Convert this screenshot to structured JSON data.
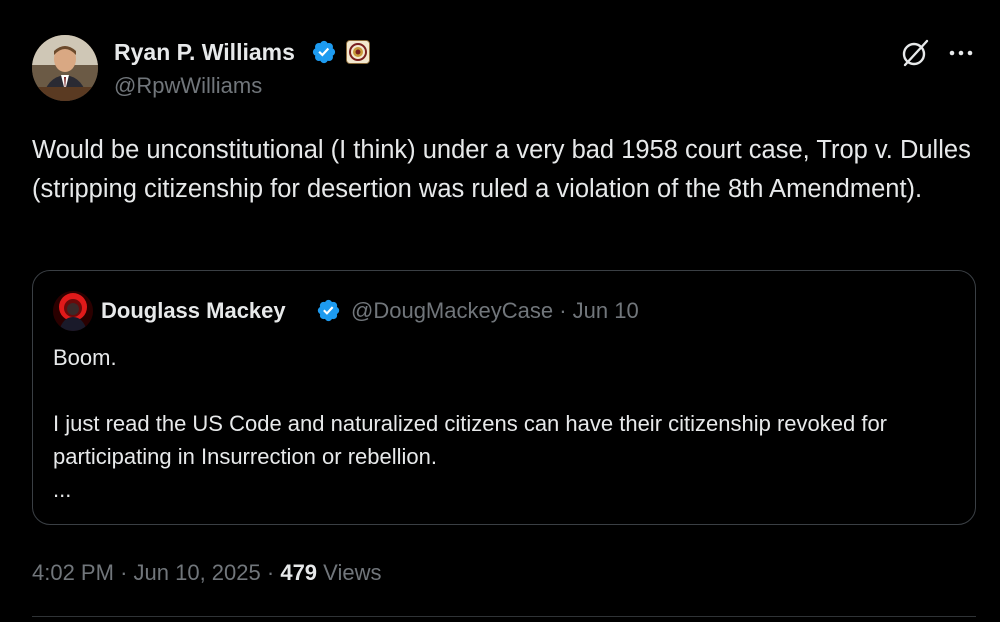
{
  "author": {
    "name": "Ryan P. Williams",
    "handle": "@RpwWilliams"
  },
  "tweet": {
    "text": "Would be unconstitutional (I think) under a very bad 1958 court case, Trop v. Dulles (stripping citizenship for desertion was ruled a violation of the 8th Amendment)."
  },
  "quote": {
    "author_name": "Douglass Mackey",
    "handle": "@DougMackeyCase",
    "separator": "·",
    "date": "Jun 10",
    "line1": "Boom.",
    "line2": "I just read the US Code and naturalized citizens can have their citizenship revoked for participating in Insurrection or rebellion.",
    "ellipsis": "..."
  },
  "meta": {
    "time": "4:02 PM",
    "separator": "·",
    "date": "Jun 10, 2025",
    "views_count": "479",
    "views_label": "Views"
  },
  "icons": {
    "verified": "verified-badge-icon",
    "grok": "grok-icon",
    "more": "more-icon"
  },
  "colors": {
    "background": "#000000",
    "text_primary": "#e7e9ea",
    "text_secondary": "#71767b",
    "verified_blue": "#1d9bf0",
    "border": "#3a3f44"
  }
}
